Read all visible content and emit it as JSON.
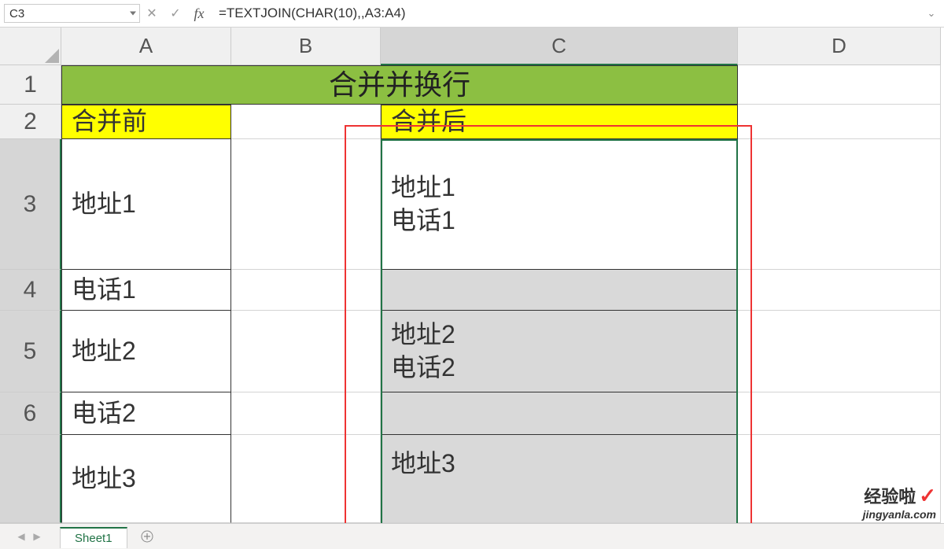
{
  "formula_bar": {
    "name_box": "C3",
    "formula": "=TEXTJOIN(CHAR(10),,A3:A4)"
  },
  "columns": [
    "A",
    "B",
    "C",
    "D"
  ],
  "rows": [
    "1",
    "2",
    "3",
    "4",
    "5",
    "6"
  ],
  "cells": {
    "title": "合并并换行",
    "a2": "合并前",
    "c2": "合并后",
    "a3": "地址1",
    "a4": "电话1",
    "a5": "地址2",
    "a6": "电话2",
    "a7": "地址3",
    "c3": "地址1\n电话1",
    "c5": "地址2\n电话2",
    "c7": "地址3"
  },
  "tabs": {
    "sheet1": "Sheet1"
  },
  "watermark": {
    "title": "经验啦",
    "url": "jingyanla.com"
  }
}
